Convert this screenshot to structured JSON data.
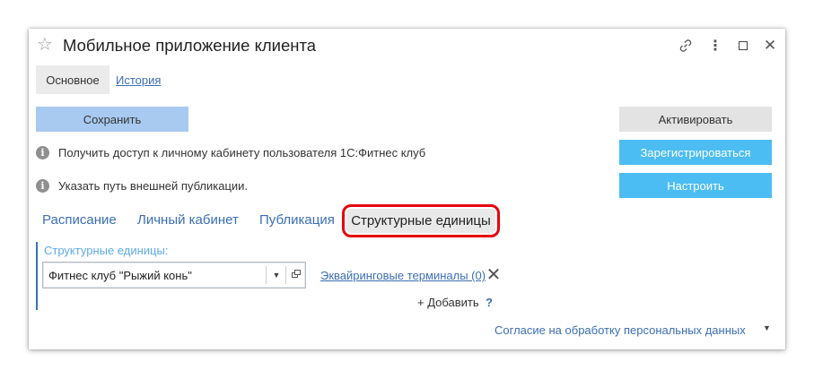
{
  "window": {
    "title": "Мобильное приложение клиента",
    "icons": {
      "favorite": "star-outline",
      "link": "link-icon",
      "more": "vertical-ellipsis",
      "maximize": "square",
      "close": "x"
    }
  },
  "tabs": {
    "main_label": "Основное",
    "history_label": "История"
  },
  "actions": {
    "save_label": "Сохранить",
    "activate_label": "Активировать",
    "register_label": "Зарегистрироваться",
    "setup_label": "Настроить"
  },
  "info": {
    "access_text": "Получить доступ к личному кабинету пользователя 1С:Фитнес клуб",
    "publication_text": "Указать путь внешней публикации."
  },
  "subtabs": [
    {
      "label": "Расписание"
    },
    {
      "label": "Личный кабинет"
    },
    {
      "label": "Публикация"
    },
    {
      "label": "Структурные единицы",
      "active": true
    }
  ],
  "units": {
    "group_label": "Структурные единицы:",
    "selected_unit": "Фитнес клуб \"Рыжий конь\"",
    "acquiring_link": "Эквайринговые терминалы (0)",
    "add_label": "+ Добавить",
    "help_label": "?"
  },
  "footer": {
    "consent_link": "Согласие на обработку персональных данных"
  },
  "colors": {
    "accent_blue": "#4cbdf2",
    "save_blue": "#a8c9f0",
    "link_blue": "#3b6fb6",
    "highlight_red": "#e8000b"
  }
}
